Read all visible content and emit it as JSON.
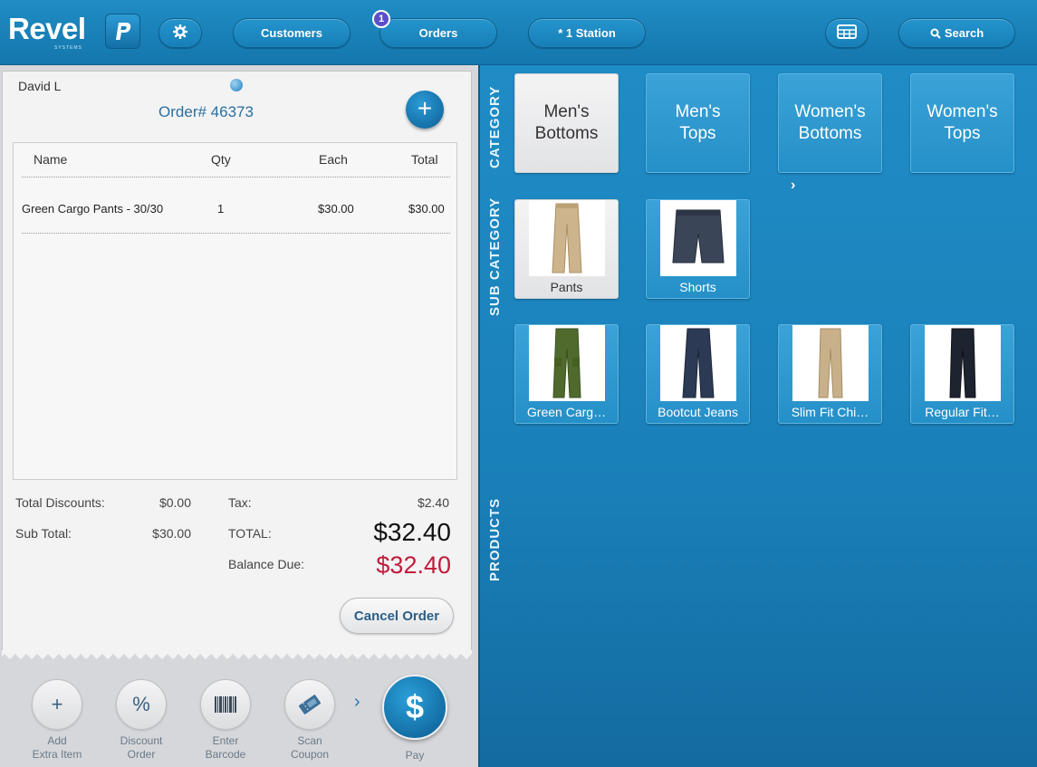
{
  "brand": {
    "name": "Revel",
    "subtitle": "SYSTEMS"
  },
  "topbar": {
    "customers_label": "Customers",
    "orders_label": "Orders",
    "orders_badge": "1",
    "station_label": "* 1 Station",
    "search_label": "Search"
  },
  "order": {
    "customer": "David L",
    "number": "Order# 46373",
    "columns": {
      "name": "Name",
      "qty": "Qty",
      "each": "Each",
      "total": "Total"
    },
    "items": [
      {
        "name": "Green Cargo Pants - 30/30",
        "qty": "1",
        "each": "$30.00",
        "total": "$30.00"
      }
    ],
    "summary": {
      "discounts_label": "Total Discounts:",
      "discounts_value": "$0.00",
      "subtotal_label": "Sub Total:",
      "subtotal_value": "$30.00",
      "tax_label": "Tax:",
      "tax_value": "$2.40",
      "total_label": "TOTAL:",
      "total_value": "$32.40",
      "balance_label": "Balance Due:",
      "balance_value": "$32.40"
    },
    "cancel_label": "Cancel Order"
  },
  "actions": [
    {
      "icon": "plus-icon",
      "line1": "Add",
      "line2": "Extra Item"
    },
    {
      "icon": "percent-icon",
      "line1": "Discount",
      "line2": "Order"
    },
    {
      "icon": "barcode-icon",
      "line1": "Enter",
      "line2": "Barcode"
    },
    {
      "icon": "coupon-icon",
      "line1": "Scan",
      "line2": "Coupon"
    }
  ],
  "pay_label": "Pay",
  "catalog": {
    "section_labels": {
      "category": "CATEGORY",
      "sub_category": "SUB CATEGORY",
      "products": "PRODUCTS"
    },
    "categories": [
      {
        "line1": "Men's",
        "line2": "Bottoms",
        "selected": true
      },
      {
        "line1": "Men's",
        "line2": "Tops",
        "selected": false
      },
      {
        "line1": "Women's",
        "line2": "Bottoms",
        "selected": false
      },
      {
        "line1": "Women's",
        "line2": "Tops",
        "selected": false
      }
    ],
    "sub_categories": [
      {
        "label": "Pants",
        "selected": true,
        "color": "#cdb48c"
      },
      {
        "label": "Shorts",
        "selected": false,
        "color": "#3b4558"
      }
    ],
    "products": [
      {
        "label": "Green Carg…",
        "color": "#4f6a2c"
      },
      {
        "label": "Bootcut Jeans",
        "color": "#2c3a55"
      },
      {
        "label": "Slim Fit Chi…",
        "color": "#c8b08a"
      },
      {
        "label": "Regular Fit…",
        "color": "#1e2330"
      }
    ]
  },
  "colors": {
    "accent": "#1a7fb5",
    "balance_due": "#c21a3a",
    "receipt_bg": "#f3f3f4"
  }
}
